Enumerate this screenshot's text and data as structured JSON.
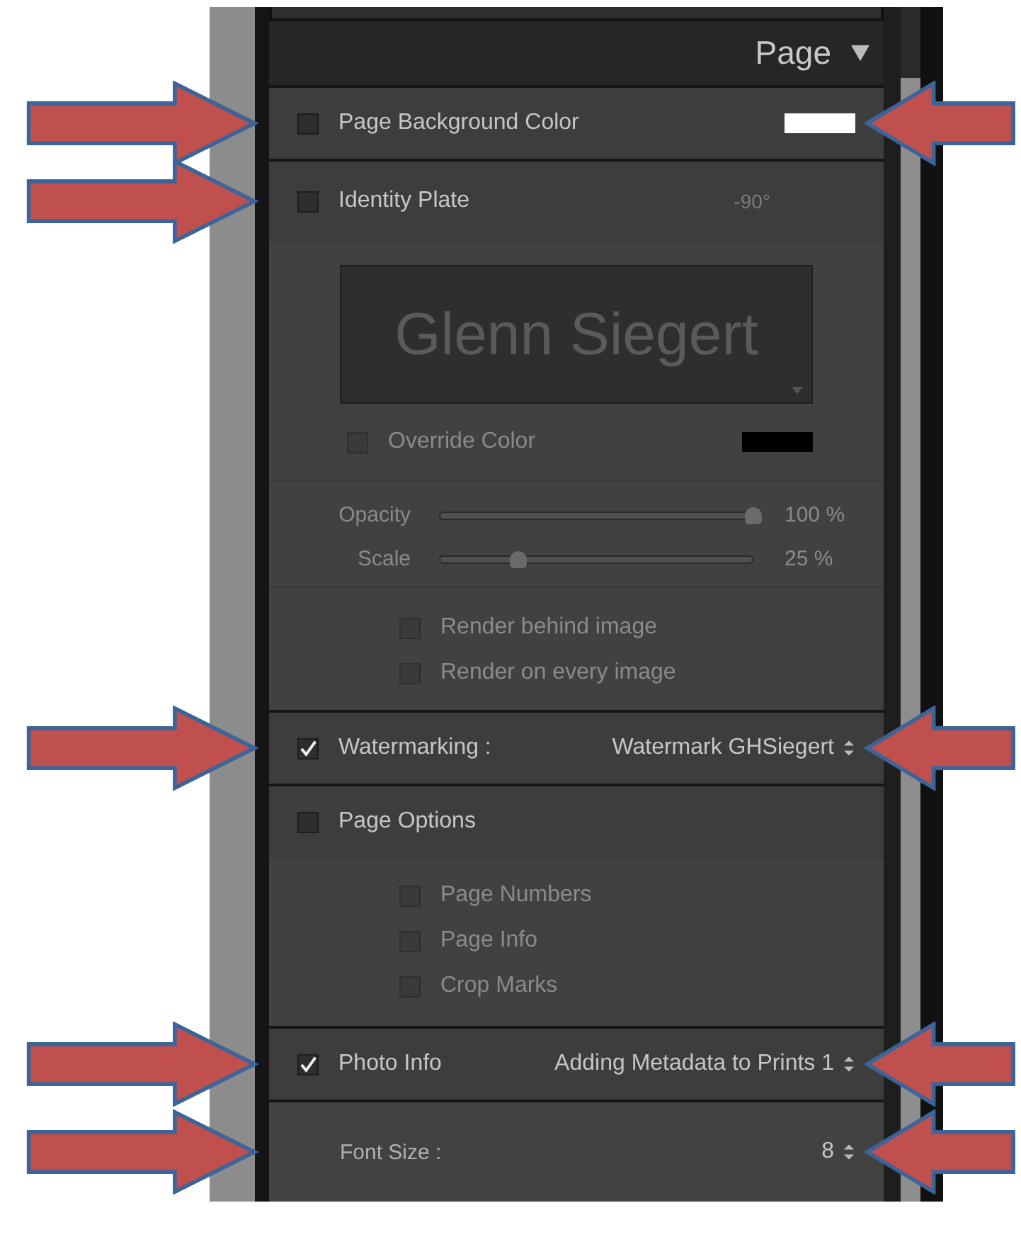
{
  "panel": {
    "title": "Page",
    "expanded": true
  },
  "page_background": {
    "label": "Page Background Color",
    "checked": false,
    "color": "#ffffff",
    "arrow_left": true,
    "arrow_right": true
  },
  "identity_plate": {
    "label": "Identity Plate",
    "checked": false,
    "rotation": "-90°",
    "plate_text": "Glenn Siegert",
    "arrow_left": true,
    "arrow_right": false,
    "override": {
      "label": "Override Color",
      "checked": false,
      "color": "#000000"
    },
    "sliders": [
      {
        "label": "Opacity",
        "level": 1.0,
        "reading": "100 %"
      },
      {
        "label": "Scale",
        "level": 0.25,
        "reading": "25 %"
      }
    ],
    "options": [
      {
        "label": "Render behind image",
        "checked": false
      },
      {
        "label": "Render on every image",
        "checked": false
      }
    ]
  },
  "watermarking": {
    "label": "Watermarking :",
    "checked": true,
    "value": "Watermark GHSiegert",
    "arrow_left": true,
    "arrow_right": true
  },
  "page_options": {
    "label": "Page Options",
    "checked": false,
    "arrow_left": false,
    "arrow_right": false,
    "options": [
      {
        "label": "Page Numbers",
        "checked": false
      },
      {
        "label": "Page Info",
        "checked": false
      },
      {
        "label": "Crop Marks",
        "checked": false
      }
    ]
  },
  "photo_info": {
    "label": "Photo Info",
    "checked": true,
    "value": "Adding Metadata to Prints 1",
    "arrow_left": true,
    "arrow_right": true
  },
  "font_size": {
    "label": "Font Size :",
    "value": "8",
    "arrow_left": true,
    "arrow_right": true
  }
}
